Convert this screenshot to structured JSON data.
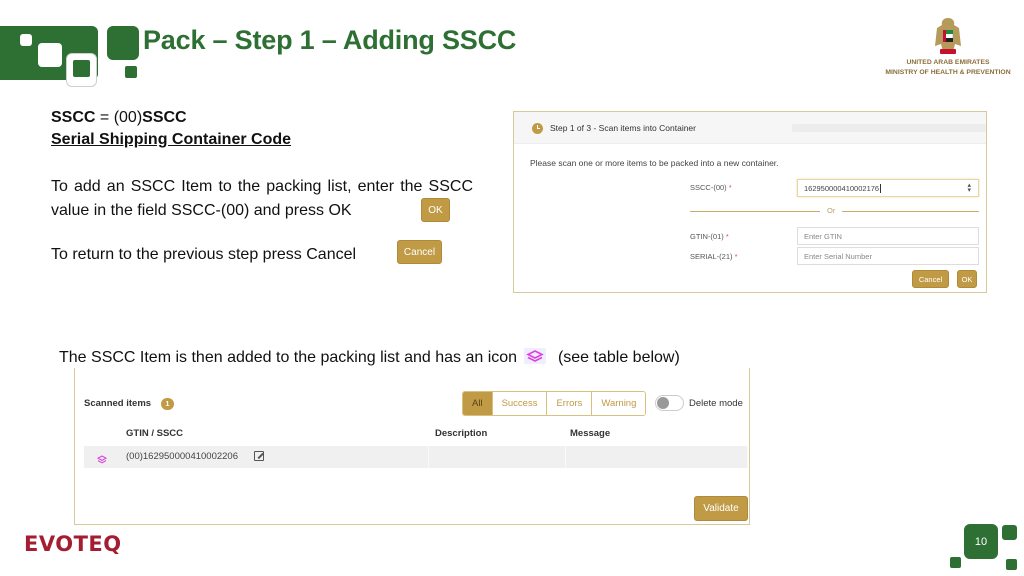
{
  "header": {
    "title": "Pack – Step 1 – Adding SSCC",
    "org_line1": "UNITED ARAB EMIRATES",
    "org_line2": "MINISTRY OF HEALTH & PREVENTION"
  },
  "left_text": {
    "sscc_term": "SSCC",
    "sscc_equals": " = (00)",
    "sscc_term2": "SSCC",
    "sscc_full": "Serial Shipping Container Code",
    "instruction_add": "To add an SSCC Item to the packing list, enter the SSCC value in the field SSCC-(00) and press OK",
    "ok_label": "OK",
    "instruction_return": "To return to the previous step press Cancel",
    "cancel_label": "Cancel"
  },
  "step_dialog": {
    "title": "Step 1 of 3 - Scan items into Container",
    "instruction": "Please scan one or more items to be packed into a new container.",
    "sscc_label": "SSCC-(00)",
    "sscc_value": "162950000410002176",
    "or_label": "Or",
    "gtin_label": "GTIN-(01)",
    "gtin_placeholder": "Enter GTIN",
    "serial_label": "SERIAL-(21)",
    "serial_placeholder": "Enter Serial Number",
    "required_mark": "*",
    "cancel_label": "Cancel",
    "ok_label": "OK"
  },
  "caption": {
    "before_icon": "The SSCC Item is then added to the packing list and has an icon",
    "after_icon": "(see table below)",
    "icon": "layers-icon"
  },
  "scanned": {
    "title": "Scanned items",
    "count": "1",
    "filters": [
      "All",
      "Success",
      "Errors",
      "Warning"
    ],
    "active_filter": "All",
    "delete_mode_label": "Delete mode",
    "delete_mode_on": false,
    "columns": [
      "GTIN / SSCC",
      "Description",
      "Message"
    ],
    "rows": [
      {
        "icon": "layers-icon",
        "code": "(00)162950000410002206",
        "description": "",
        "message": ""
      }
    ],
    "validate_label": "Validate"
  },
  "footer": {
    "brand": "EVOTEQ",
    "page_number": "10"
  },
  "colors": {
    "brand_green": "#2e6f34",
    "gold": "#c09a45",
    "evoteq_red": "#a41d31",
    "sscc_icon": "#e040e0"
  }
}
